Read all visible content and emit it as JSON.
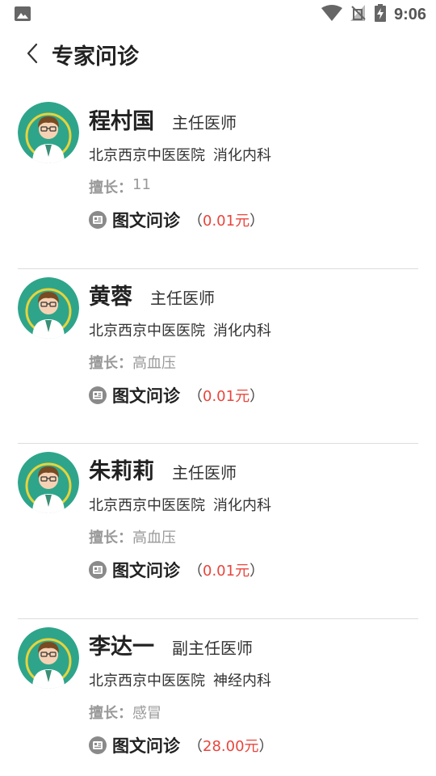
{
  "status_bar": {
    "time": "9:06"
  },
  "header": {
    "title": "专家问诊"
  },
  "doctors": [
    {
      "name": "程村国",
      "title": "主任医师",
      "hospital": "北京西京中医医院",
      "department": "消化内科",
      "skill_label": "擅长：",
      "skill": "11",
      "consult_label": "图文问诊",
      "paren_open": "（",
      "price": "0.01元",
      "paren_close": "）"
    },
    {
      "name": "黄蓉",
      "title": "主任医师",
      "hospital": "北京西京中医医院",
      "department": "消化内科",
      "skill_label": "擅长：",
      "skill": "高血压",
      "consult_label": "图文问诊",
      "paren_open": "（",
      "price": "0.01元",
      "paren_close": "）"
    },
    {
      "name": "朱莉莉",
      "title": "主任医师",
      "hospital": "北京西京中医医院",
      "department": "消化内科",
      "skill_label": "擅长：",
      "skill": "高血压",
      "consult_label": "图文问诊",
      "paren_open": "（",
      "price": "0.01元",
      "paren_close": "）"
    },
    {
      "name": "李达一",
      "title": "副主任医师",
      "hospital": "北京西京中医医院",
      "department": "神经内科",
      "skill_label": "擅长：",
      "skill": "感冒",
      "consult_label": "图文问诊",
      "paren_open": "（",
      "price": "28.00元",
      "paren_close": "）"
    }
  ],
  "colors": {
    "price": "#e8453c",
    "avatar_bg": "#2ea58a",
    "avatar_ring": "#e6d33c"
  },
  "icons": {
    "back": "chevron-left-icon",
    "consult": "chat-card-icon",
    "status_image": "image-icon",
    "wifi": "wifi-icon",
    "signal": "no-signal-icon",
    "battery": "battery-charging-icon"
  }
}
